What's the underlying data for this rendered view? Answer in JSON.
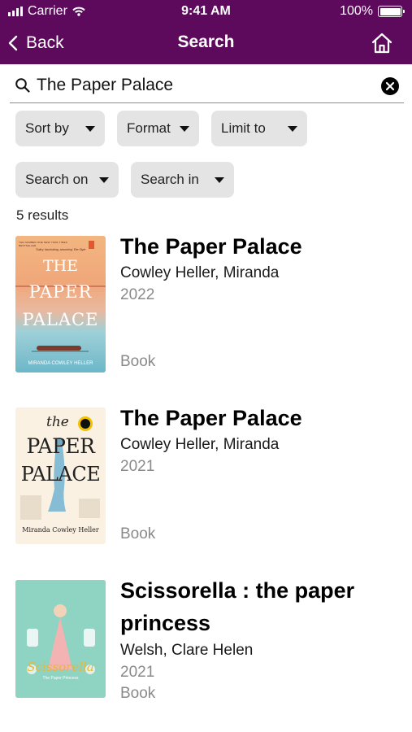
{
  "status_bar": {
    "carrier": "Carrier",
    "time": "9:41 AM",
    "battery": "100%"
  },
  "nav": {
    "back_label": "Back",
    "title": "Search"
  },
  "search": {
    "value": "The Paper Palace"
  },
  "filters": {
    "sort_by": "Sort by",
    "format": "Format",
    "limit_to": "Limit to",
    "search_on": "Search on",
    "search_in": "Search in"
  },
  "results_count": "5 results",
  "results": [
    {
      "title": "The Paper Palace",
      "author": "Cowley Heller, Miranda",
      "year": "2022",
      "format": "Book",
      "cover": {
        "tagline": "THE NUMBER ONE NEW YORK TIMES BESTSELLER",
        "quote": "'Sultry, fascinating, absorbing' Elle Style",
        "title_lines": [
          "THE",
          "PAPER",
          "PALACE"
        ],
        "author": "MIRANDA COWLEY HELLER"
      }
    },
    {
      "title": "The Paper Palace",
      "author": "Cowley Heller, Miranda",
      "year": "2021",
      "format": "Book",
      "cover": {
        "title_lines": [
          "the",
          "PAPER",
          "PALACE"
        ],
        "author": "Miranda Cowley Heller"
      }
    },
    {
      "title_lines": [
        "Scissorella : the paper",
        "princess"
      ],
      "author": "Welsh, Clare Helen",
      "year": "2021",
      "format": "Book",
      "cover": {
        "title": "Scissorella",
        "subtitle": "The Paper Princess"
      }
    }
  ],
  "colors": {
    "header": "#5d0a5c",
    "chip": "#e4e4e4",
    "muted_text": "#8a8a8a"
  }
}
